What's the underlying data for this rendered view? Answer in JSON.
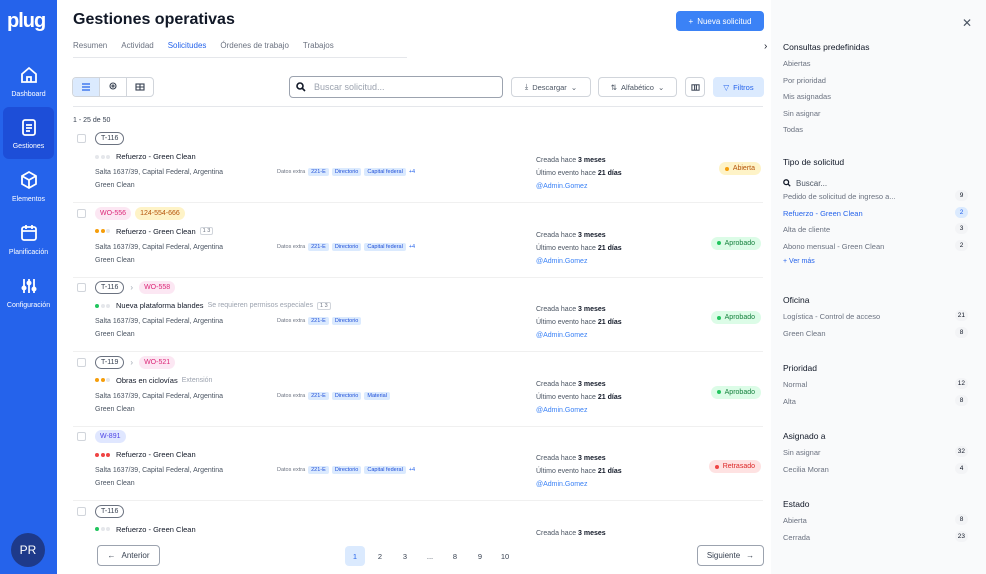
{
  "brand": {
    "logo": "plug"
  },
  "nav": {
    "items": [
      {
        "label": "Dashboard"
      },
      {
        "label": "Gestiones"
      },
      {
        "label": "Elementos"
      },
      {
        "label": "Planificación"
      },
      {
        "label": "Configuración"
      }
    ],
    "avatar": "PR"
  },
  "header": {
    "title": "Gestiones operativas",
    "new_button": "Nueva solicitud",
    "tabs": [
      "Resumen",
      "Actividad",
      "Solicitudes",
      "Órdenes de trabajo",
      "Trabajos"
    ],
    "active_tab": "Solicitudes"
  },
  "toolbar": {
    "search_placeholder": "Buscar solicitud...",
    "download": "Descargar",
    "sort": "Alfabético",
    "filters": "Filtros"
  },
  "list": {
    "count": "1 - 25 de 50",
    "rows": [
      {
        "codes": [
          "T-116"
        ],
        "title": "Refuerzo - Green Clean",
        "subtitle": "",
        "mini": "",
        "address": "Salta 1637/39, Capital Federal, Argentina",
        "client": "Green Clean",
        "extra_label": "Datos extra",
        "tags": [
          "221-E",
          "Directorio",
          "Capital federal"
        ],
        "more": "+4",
        "created_prefix": "Creada hace",
        "created": "3 meses",
        "event_prefix": "Último evento hace",
        "event": "21 días",
        "user": "@Admin.Gomez",
        "status": "Abierta"
      },
      {
        "codes": [
          "WO-556",
          "124-554-666"
        ],
        "title": "Refuerzo - Green Clean",
        "subtitle": "",
        "mini": "1 3",
        "address": "Salta 1637/39, Capital Federal, Argentina",
        "client": "Green Clean",
        "extra_label": "Datos extra",
        "tags": [
          "221-E",
          "Directorio",
          "Capital federal"
        ],
        "more": "+4",
        "created_prefix": "Creada hace",
        "created": "3 meses",
        "event_prefix": "Último evento hace",
        "event": "21 días",
        "user": "@Admin.Gomez",
        "status": "Aprobado"
      },
      {
        "codes": [
          "T-116",
          "WO-558"
        ],
        "title": "Nueva plataforma blandes",
        "subtitle": "Se requieren permisos especiales",
        "mini": "1 3",
        "address": "Salta 1637/39, Capital Federal, Argentina",
        "client": "Green Clean",
        "extra_label": "Datos extra",
        "tags": [
          "221-E",
          "Directorio"
        ],
        "more": "",
        "created_prefix": "Creada hace",
        "created": "3 meses",
        "event_prefix": "Último evento hace",
        "event": "21 días",
        "user": "@Admin.Gomez",
        "status": "Aprobado"
      },
      {
        "codes": [
          "T-119",
          "WO-521"
        ],
        "title": "Obras en ciclovías",
        "subtitle": "Extensión",
        "mini": "",
        "address": "Salta 1637/39, Capital Federal, Argentina",
        "client": "Green Clean",
        "extra_label": "Datos extra",
        "tags": [
          "221-E",
          "Directorio",
          "Material"
        ],
        "more": "",
        "created_prefix": "Creada hace",
        "created": "3 meses",
        "event_prefix": "Último evento hace",
        "event": "21 días",
        "user": "@Admin.Gomez",
        "status": "Aprobado"
      },
      {
        "codes": [
          "W-891"
        ],
        "title": "Refuerzo - Green Clean",
        "subtitle": "",
        "mini": "",
        "address": "Salta 1637/39, Capital Federal, Argentina",
        "client": "Green Clean",
        "extra_label": "Datos extra",
        "tags": [
          "221-E",
          "Directorio",
          "Capital federal"
        ],
        "more": "+4",
        "created_prefix": "Creada hace",
        "created": "3 meses",
        "event_prefix": "Último evento hace",
        "event": "21 días",
        "user": "@Admin.Gomez",
        "status": "Retrasado"
      },
      {
        "codes": [
          "T-116"
        ],
        "title": "Refuerzo - Green Clean",
        "subtitle": "",
        "mini": "",
        "address": "",
        "client": "",
        "extra_label": "",
        "tags": [],
        "more": "",
        "created_prefix": "Creada hace",
        "created": "3 meses",
        "event_prefix": "",
        "event": "",
        "user": "",
        "status": ""
      }
    ]
  },
  "pagination": {
    "prev": "Anterior",
    "next": "Siguiente",
    "pages": [
      "1",
      "2",
      "3",
      "...",
      "8",
      "9",
      "10"
    ],
    "current": "1"
  },
  "panel": {
    "predefined": {
      "title": "Consultas predefinidas",
      "items": [
        "Abiertas",
        "Por prioridad",
        "Mis asignadas",
        "Sin asignar",
        "Todas"
      ]
    },
    "tipo": {
      "title": "Tipo de solicitud",
      "search": "Buscar...",
      "items": [
        {
          "label": "Pedido de solicitud de ingreso a...",
          "count": "9"
        },
        {
          "label": "Refuerzo - Green Clean",
          "count": "2"
        },
        {
          "label": "Alta de cliente",
          "count": "3"
        },
        {
          "label": "Abono mensual - Green Clean",
          "count": "2"
        }
      ],
      "more": "Ver más"
    },
    "oficina": {
      "title": "Oficina",
      "items": [
        {
          "label": "Logística - Control de acceso",
          "count": "21"
        },
        {
          "label": "Green Clean",
          "count": "8"
        }
      ]
    },
    "prioridad": {
      "title": "Prioridad",
      "items": [
        {
          "label": "Normal",
          "count": "12"
        },
        {
          "label": "Alta",
          "count": "8"
        }
      ]
    },
    "asignado": {
      "title": "Asignado a",
      "items": [
        {
          "label": "Sin asignar",
          "count": "32"
        },
        {
          "label": "Cecilia Moran",
          "count": "4"
        }
      ]
    },
    "estado": {
      "title": "Estado",
      "items": [
        {
          "label": "Abierta",
          "count": "8"
        },
        {
          "label": "Cerrada",
          "count": "23"
        }
      ]
    }
  },
  "colors": {
    "brand": "#2563eb",
    "open": "#f59e0b",
    "approved": "#22c55e",
    "delayed": "#ef4444"
  }
}
